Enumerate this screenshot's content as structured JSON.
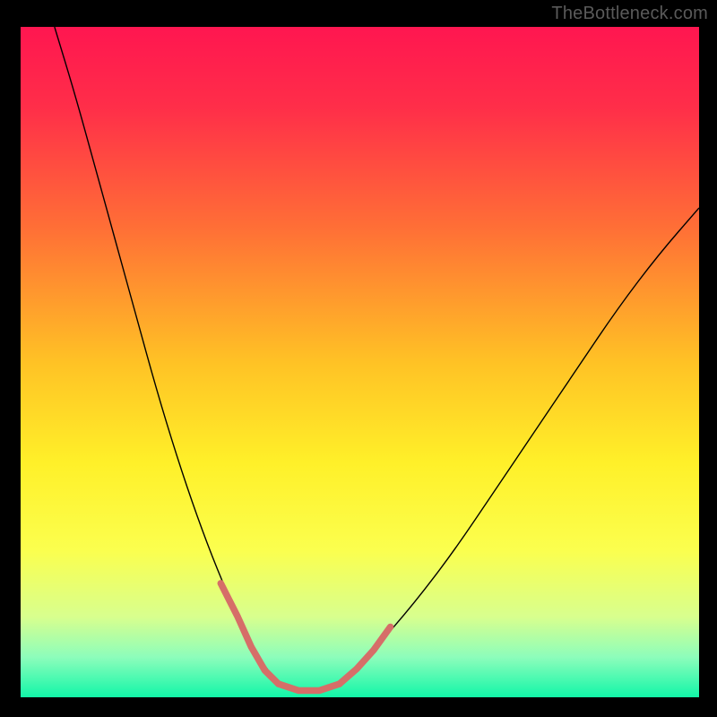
{
  "watermark": "TheBottleneck.com",
  "chart_data": {
    "type": "line",
    "title": "",
    "xlabel": "",
    "ylabel": "",
    "xlim": [
      0,
      100
    ],
    "ylim": [
      0,
      100
    ],
    "grid": false,
    "legend": false,
    "background": {
      "type": "vertical-gradient",
      "stops": [
        {
          "pos": 0.0,
          "color": "#ff1650"
        },
        {
          "pos": 0.12,
          "color": "#ff2e49"
        },
        {
          "pos": 0.3,
          "color": "#ff6f36"
        },
        {
          "pos": 0.5,
          "color": "#ffc225"
        },
        {
          "pos": 0.65,
          "color": "#fff029"
        },
        {
          "pos": 0.78,
          "color": "#fbff4e"
        },
        {
          "pos": 0.88,
          "color": "#d8ff8e"
        },
        {
          "pos": 0.94,
          "color": "#8dfdbb"
        },
        {
          "pos": 1.0,
          "color": "#12f6a8"
        }
      ]
    },
    "series": [
      {
        "name": "left-curve",
        "stroke": "#000000",
        "stroke_width": 1.4,
        "x": [
          5,
          8,
          11,
          14,
          17,
          20,
          23,
          26,
          29,
          32,
          35,
          38
        ],
        "y": [
          100,
          90,
          79,
          68,
          57,
          46,
          36,
          27,
          19,
          12,
          6,
          2
        ]
      },
      {
        "name": "valley-floor",
        "stroke": "#000000",
        "stroke_width": 1.4,
        "x": [
          38,
          41,
          44,
          47
        ],
        "y": [
          2,
          1,
          1,
          2
        ]
      },
      {
        "name": "right-curve",
        "stroke": "#000000",
        "stroke_width": 1.4,
        "x": [
          47,
          52,
          58,
          64,
          70,
          76,
          82,
          88,
          94,
          100
        ],
        "y": [
          2,
          7,
          14,
          22,
          31,
          40,
          49,
          58,
          66,
          73
        ]
      },
      {
        "name": "left-highlight",
        "stroke": "#d66e68",
        "stroke_width": 7.5,
        "linecap": "round",
        "x": [
          29.5,
          32,
          34,
          36,
          38
        ],
        "y": [
          17,
          12,
          7.5,
          4,
          2
        ]
      },
      {
        "name": "floor-highlight",
        "stroke": "#d66e68",
        "stroke_width": 7.5,
        "linecap": "round",
        "x": [
          38,
          41,
          44,
          47
        ],
        "y": [
          2,
          1,
          1,
          2
        ]
      },
      {
        "name": "right-highlight",
        "stroke": "#d66e68",
        "stroke_width": 7.5,
        "linecap": "round",
        "x": [
          47,
          49.5,
          52,
          54.5
        ],
        "y": [
          2,
          4.2,
          7,
          10.5
        ]
      }
    ]
  }
}
